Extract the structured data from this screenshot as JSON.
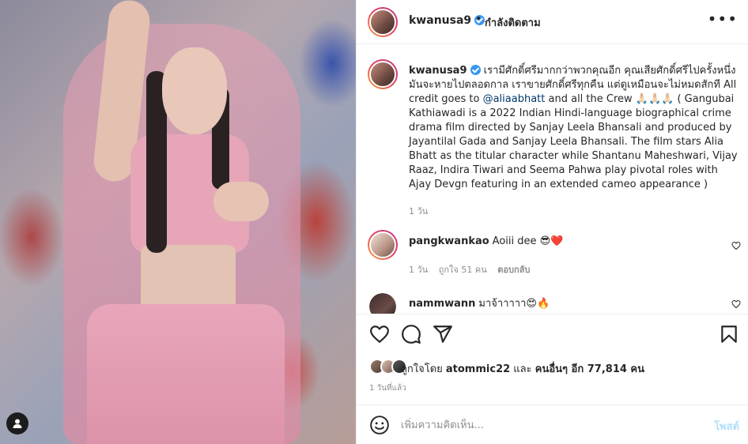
{
  "post": {
    "author": "kwanusa9",
    "follow_dot": "•",
    "following_label": "กำลังติดตาม",
    "more_icon": "more-horizontal-icon"
  },
  "caption": {
    "username": "kwanusa9",
    "text_part1": "เรามีศักดิ์ศรีมากกว่าพวกคุณอีก คุณเสียศักดิ์ศรีไปครั้งหนึ่ง มันจะหายไปตลอดกาล เราขายศักดิ์ศรีทุกคืน แต่ดูเหมือนจะไม่หมดสักที All credit goes to ",
    "mention": "@aliaabhatt",
    "text_part2": " and all the Crew 🙏🏻🙏🏻🙏🏻 ( Gangubai Kathiawadi is a 2022 Indian Hindi-language biographical crime drama film directed by Sanjay Leela Bhansali and produced by Jayantilal Gada and Sanjay Leela Bhansali. The film stars Alia Bhatt as the titular character while Shantanu Maheshwari, Vijay Raaz, Indira Tiwari and Seema Pahwa play pivotal roles with Ajay Devgn featuring in an extended cameo appearance )",
    "time": "1 วัน"
  },
  "comments": [
    {
      "username": "pangkwankao",
      "text": "Aoiii dee 😎❤️",
      "time": "1 วัน",
      "likes": "ถูกใจ 51 คน",
      "reply": "ตอบกลับ"
    },
    {
      "username": "nammwann",
      "text": "มาจ้าาาาา😍🔥"
    }
  ],
  "likes": {
    "prefix": "ถูกใจโดย ",
    "first_user": "atommic22",
    "middle": " และ ",
    "others": "คนอื่นๆ อีก 77,814 คน"
  },
  "post_time": "1 วันที่แล้ว",
  "add_comment": {
    "placeholder": "เพิ่มความคิดเห็น...",
    "post_label": "โพสต์"
  },
  "colors": {
    "verified": "#3897f0",
    "link": "#00376b",
    "post_button_disabled": "#b2dffc",
    "muted": "#8e8e8e"
  }
}
